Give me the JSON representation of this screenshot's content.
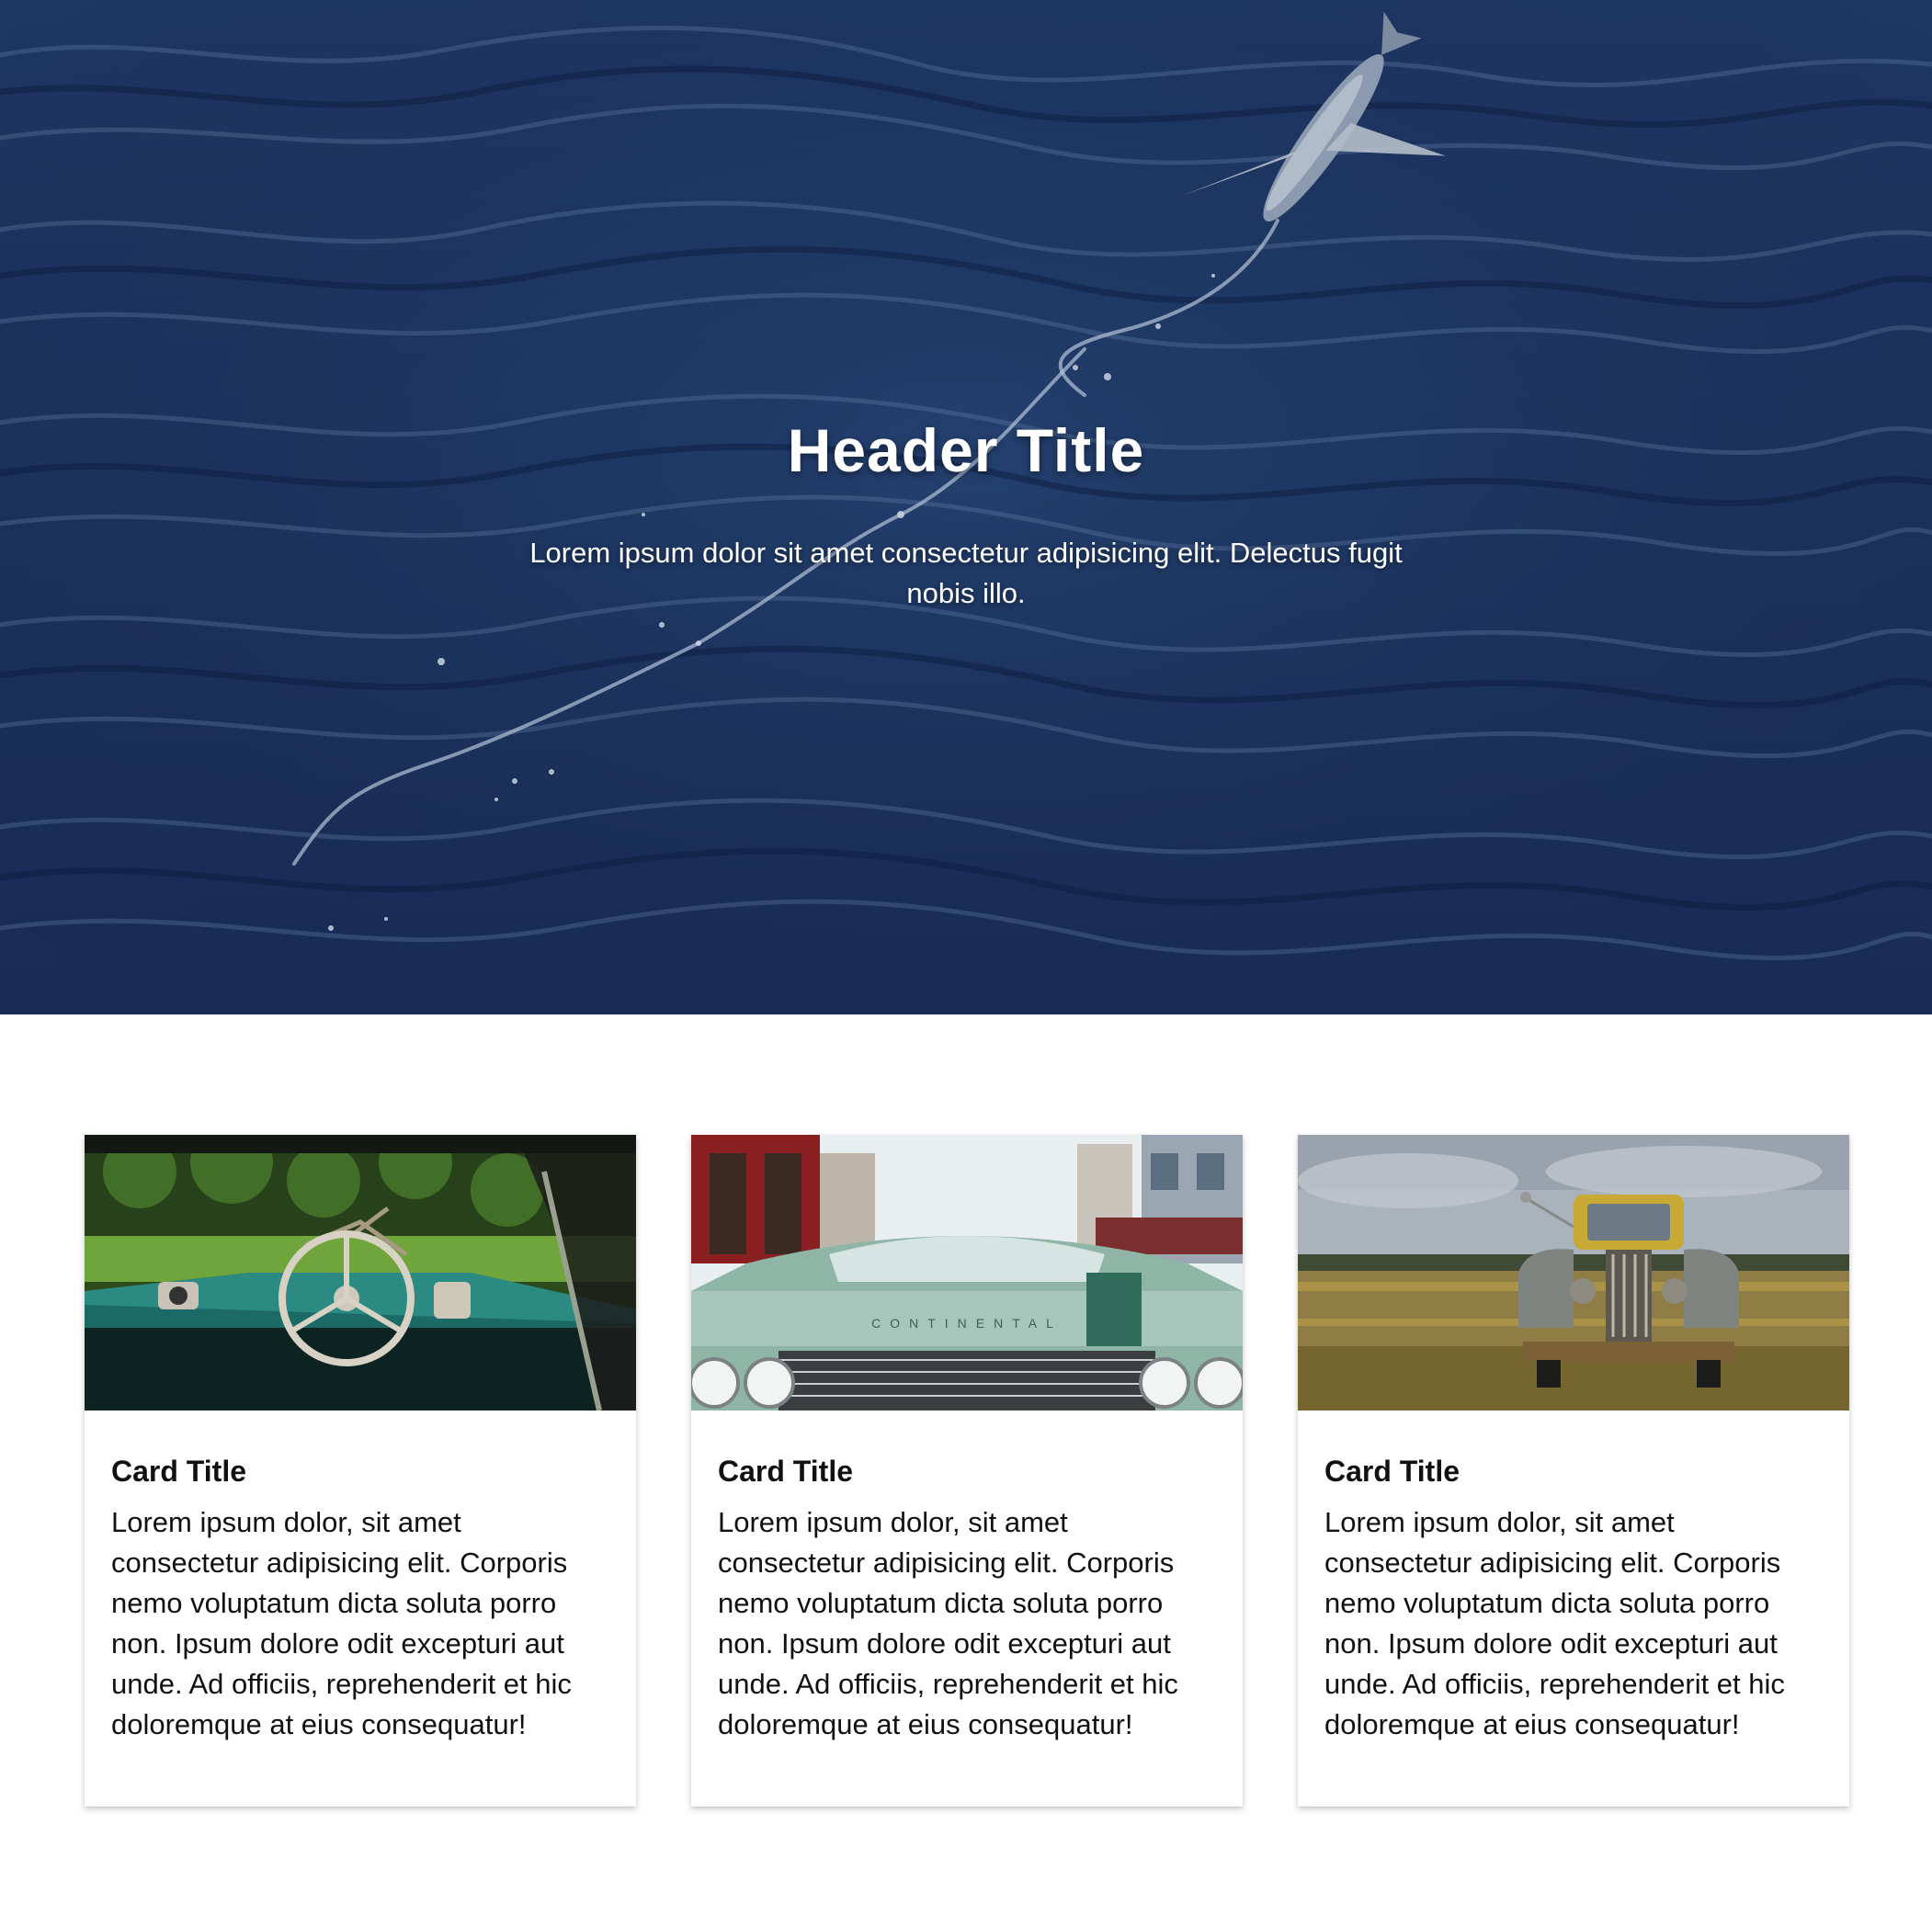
{
  "hero": {
    "title": "Header Title",
    "subtitle": "Lorem ipsum dolor sit amet consectetur adipisicing elit. Delectus fugit nobis illo."
  },
  "cards": [
    {
      "title": "Card Title",
      "text": "Lorem ipsum dolor, sit amet consectetur adipisicing elit. Corporis nemo voluptatum dicta soluta porro non. Ipsum dolore odit excepturi aut unde. Ad officiis, reprehenderit et hic doloremque at eius consequatur!"
    },
    {
      "title": "Card Title",
      "text": "Lorem ipsum dolor, sit amet consectetur adipisicing elit. Corporis nemo voluptatum dicta soluta porro non. Ipsum dolore odit excepturi aut unde. Ad officiis, reprehenderit et hic doloremque at eius consequatur!"
    },
    {
      "title": "Card Title",
      "text": "Lorem ipsum dolor, sit amet consectetur adipisicing elit. Corporis nemo voluptatum dicta soluta porro non. Ipsum dolore odit excepturi aut unde. Ad officiis, reprehenderit et hic doloremque at eius consequatur!"
    }
  ],
  "images": {
    "hero": "ocean-with-flying-fish-photo",
    "card_1": "vintage-car-interior-steering-wheel-photo",
    "card_2": "vintage-green-car-front-grille-photo",
    "card_3": "rusty-yellow-truck-in-field-photo"
  },
  "card_2_grille_text": "CONTINENTAL"
}
